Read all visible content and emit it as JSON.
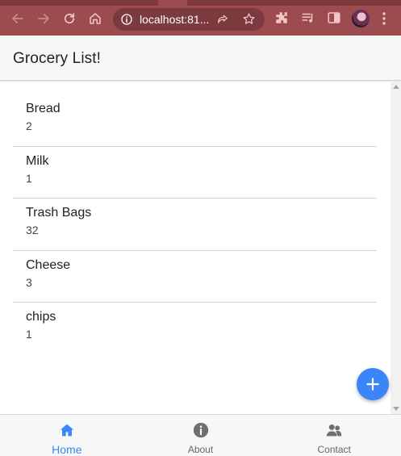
{
  "browser": {
    "url": "localhost:81...",
    "colors": {
      "frame": "#9c4b4f",
      "omnibox": "#7a3a3e",
      "icon": "#f4c6c8"
    }
  },
  "header": {
    "title": "Grocery List!"
  },
  "items": [
    {
      "name": "Bread",
      "qty": "2"
    },
    {
      "name": "Milk",
      "qty": "1"
    },
    {
      "name": "Trash Bags",
      "qty": "32"
    },
    {
      "name": "Cheese",
      "qty": "3"
    },
    {
      "name": "chips",
      "qty": "1"
    }
  ],
  "fab": {
    "icon": "plus-icon",
    "color": "#3a85f7"
  },
  "tabs": [
    {
      "label": "Home",
      "icon": "home-icon",
      "active": true
    },
    {
      "label": "About",
      "icon": "info-icon",
      "active": false
    },
    {
      "label": "Contact",
      "icon": "people-icon",
      "active": false
    }
  ]
}
